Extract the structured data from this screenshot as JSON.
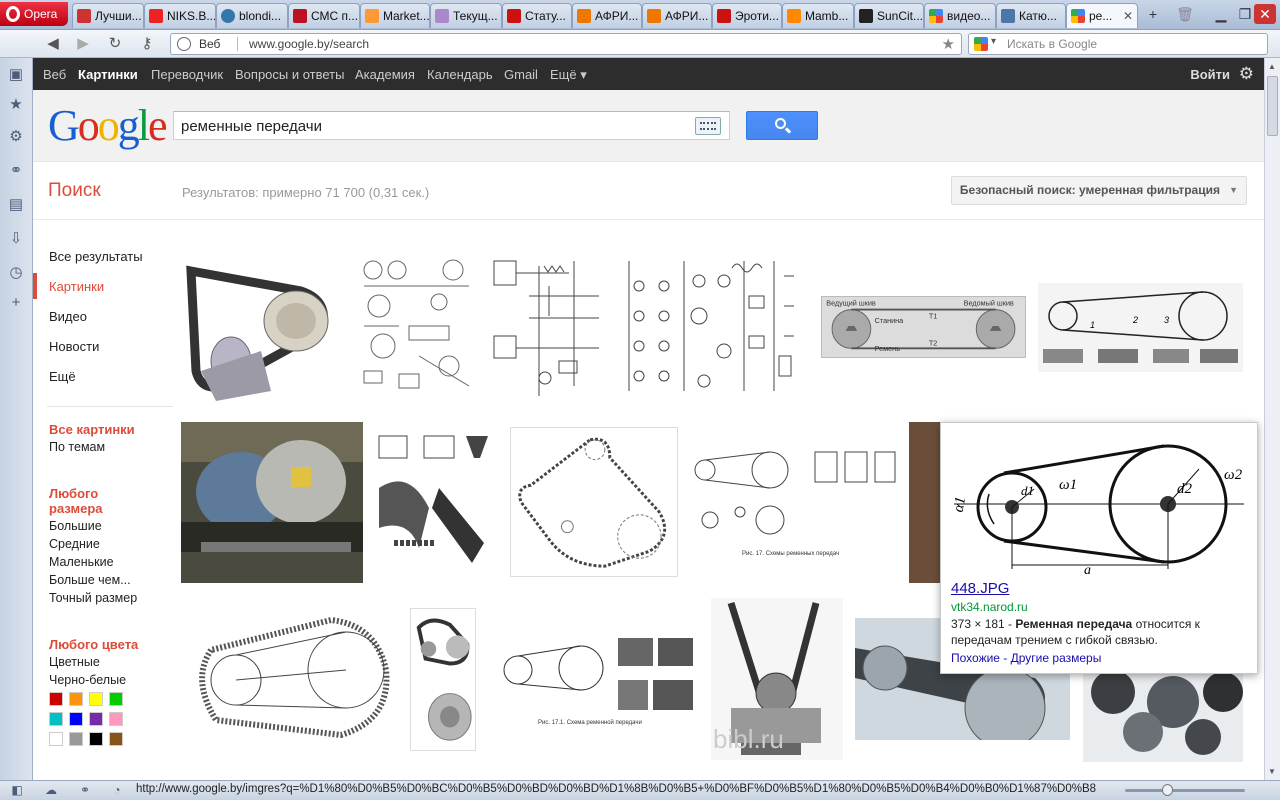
{
  "browser": {
    "menu_label": "Opera",
    "tabs": [
      {
        "label": "Лучши..."
      },
      {
        "label": "NIKS.B..."
      },
      {
        "label": "blondi..."
      },
      {
        "label": "СМС п..."
      },
      {
        "label": "Market..."
      },
      {
        "label": "Текущ..."
      },
      {
        "label": "Стату..."
      },
      {
        "label": "АФРИ..."
      },
      {
        "label": "АФРИ..."
      },
      {
        "label": "Эроти..."
      },
      {
        "label": "Mamb..."
      },
      {
        "label": "SunCit..."
      },
      {
        "label": "видео..."
      },
      {
        "label": "Катю..."
      },
      {
        "label": "ре..."
      }
    ],
    "address": {
      "mode": "Веб",
      "url": "www.google.by/search"
    },
    "search_placeholder": "Искать в Google",
    "status_url": "http://www.google.by/imgres?q=%D1%80%D0%B5%D0%BC%D0%B5%D0%BD%D0%BD%D1%8B%D0%B5+%D0%BF%D0%B5%D1%80%D0%B5%D0%B4%D0%B0%D1%87%D0%B8&hl..."
  },
  "gbar": {
    "items": [
      "Веб",
      "Картинки",
      "Переводчик",
      "Вопросы и ответы",
      "Академия",
      "Календарь",
      "Gmail",
      "Ещё ▾"
    ],
    "login": "Войти"
  },
  "search": {
    "logo": "Google",
    "query": "ременные передачи",
    "section_title": "Поиск",
    "results": "Результатов: примерно 71 700 (0,31 сек.)",
    "safe_search": "Безопасный поиск: умеренная фильтрация"
  },
  "left_nav": {
    "types": [
      "Все результаты",
      "Картинки",
      "Видео",
      "Новости",
      "Ещё"
    ],
    "all_images": "Все картинки",
    "by_topic": "По темам",
    "size_title": "Любого размера",
    "sizes": [
      "Большие",
      "Средние",
      "Маленькие",
      "Больше чем...",
      "Точный размер"
    ],
    "color_title": "Любого цвета",
    "colors_opts": [
      "Цветные",
      "Черно-белые"
    ],
    "swatches": [
      "#cc0000",
      "#fb940b",
      "#ffff00",
      "#00cc00",
      "#03c0c6",
      "#0000ff",
      "#762ca7",
      "#ff98bf",
      "#ffffff",
      "#999999",
      "#000000",
      "#885418"
    ]
  },
  "images": {
    "diagram_labels": {
      "drive_pulley": "Ведущий шкив",
      "driven_pulley": "Ведомый шкив",
      "frame": "Станина",
      "belt": "Ремень",
      "t1": "T1",
      "t2": "T2",
      "fig17": "Рис. 17. Схемы ременных передач",
      "fig171": "Рис. 17.1. Схема ременной передачи",
      "watermark": "bibl.ru"
    }
  },
  "popup": {
    "filename": "448.JPG",
    "site": "vtk34.narod.ru",
    "size": "373 × 181 - ",
    "bold": "Ременная передача",
    "desc_rest": " относится к передачам трением с гибкой связью.",
    "links": "Похожие - Другие размеры",
    "labels": {
      "a1": "α1",
      "d1": "d1",
      "w1": "ω1",
      "d2": "d2",
      "w2": "ω2",
      "a": "a"
    }
  }
}
